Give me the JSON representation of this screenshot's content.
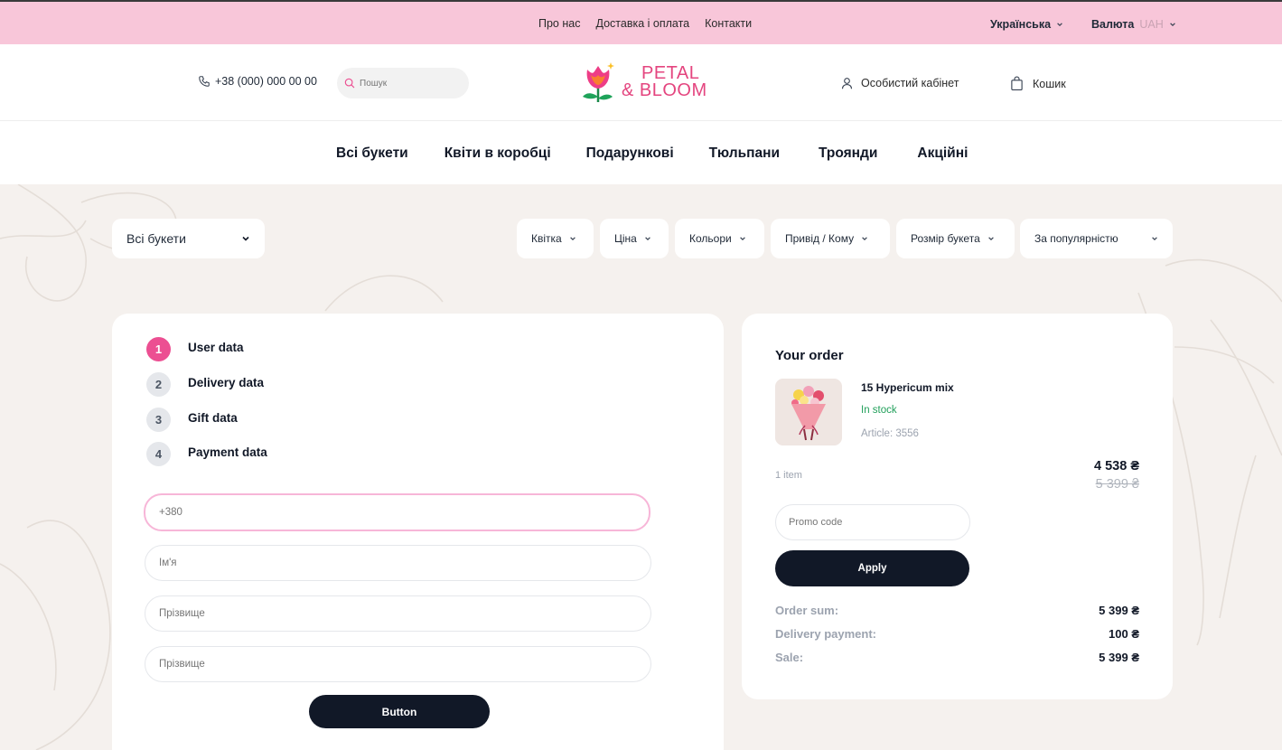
{
  "topbar": {
    "links": [
      "Про нас",
      "Доставка і оплата",
      "Контакти"
    ],
    "language": "Українська",
    "currency_label": "Валюта",
    "currency_value": "UAH"
  },
  "header": {
    "phone": "+38 (000) 000 00 00",
    "search_placeholder": "Пошук",
    "logo_line1": "PETAL",
    "logo_line2": "& BLOOM",
    "cabinet": "Особистий кабінет",
    "cart": "Кошик"
  },
  "categories": [
    "Всі букети",
    "Квіти в коробці",
    "Подарункові",
    "Тюльпани",
    "Троянди",
    "Акційні"
  ],
  "filters": {
    "main": "Всі букети",
    "items": [
      "Квітка",
      "Ціна",
      "Кольори",
      "Привід / Кому",
      "Розмір букета",
      "За популярністю"
    ]
  },
  "checkout": {
    "steps": [
      {
        "num": "1",
        "label": "User data"
      },
      {
        "num": "2",
        "label": "Delivery data"
      },
      {
        "num": "3",
        "label": "Gift data"
      },
      {
        "num": "4",
        "label": "Payment data"
      }
    ],
    "fields": [
      "+380",
      "Ім'я",
      "Прізвище",
      "Прізвище"
    ],
    "button": "Button"
  },
  "order": {
    "title": "Your order",
    "product_name": "15 Hypericum mix",
    "stock": "In stock",
    "article": "Article: 3556",
    "item_count": "1 item",
    "price_now": "4 538 ₴",
    "price_old": "5 399 ₴",
    "promo_placeholder": "Promo code",
    "apply": "Apply",
    "summary": [
      {
        "label": "Order sum:",
        "value": "5 399 ₴"
      },
      {
        "label": "Delivery payment:",
        "value": "100 ₴"
      },
      {
        "label": "Sale:",
        "value": "5 399 ₴"
      }
    ]
  },
  "colors": {
    "topbar": "#f8c6d9",
    "accent": "#ec4f92",
    "dark": "#111827",
    "in_stock": "#22a05b",
    "page_bg": "#f5f1ee"
  }
}
